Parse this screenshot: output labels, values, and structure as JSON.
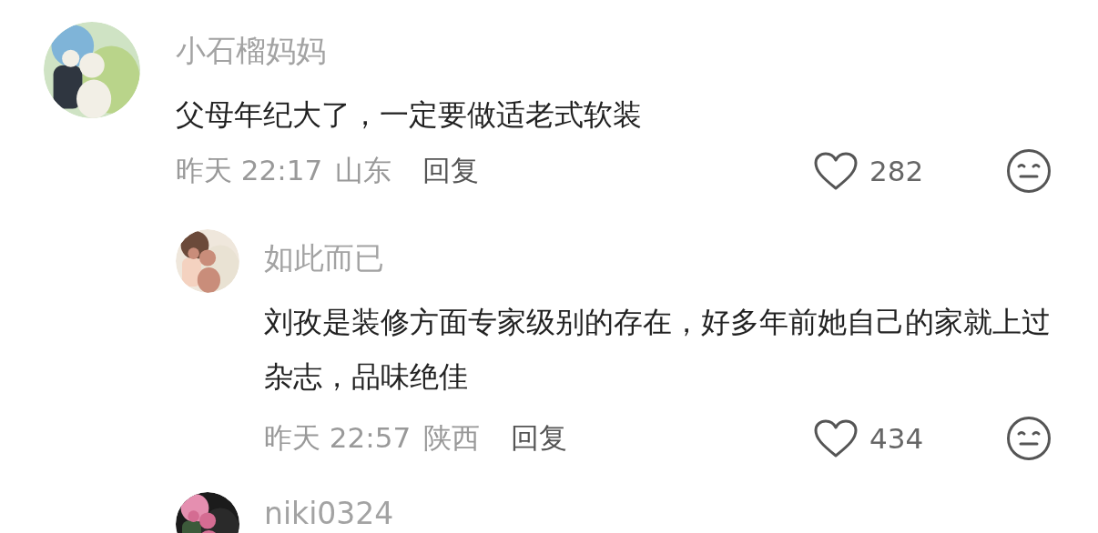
{
  "comments": [
    {
      "name": "小石榴妈妈",
      "text": "父母年纪大了，一定要做适老式软装",
      "time": "昨天 22:17",
      "location": "山东",
      "reply": "回复",
      "likes": "282",
      "children": [
        {
          "name": "如此而已",
          "text": "刘孜是装修方面专家级别的存在，好多年前她自己的家就上过杂志，品味绝佳",
          "time": "昨天 22:57",
          "location": "陕西",
          "reply": "回复",
          "likes": "434"
        },
        {
          "name": "niki0324"
        }
      ]
    }
  ]
}
